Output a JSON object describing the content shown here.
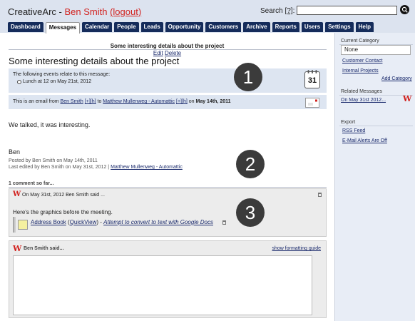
{
  "header": {
    "app_name": "CreativeArc",
    "separator": " - ",
    "user_name": "Ben Smith",
    "logout_label": "(logout)",
    "search_label": "Search",
    "search_help": "[?]",
    "search_colon": ":",
    "search_value": "",
    "search_button_icon": "magnifier-icon"
  },
  "tabs": [
    {
      "label": "Dashboard",
      "active": false
    },
    {
      "label": "Messages",
      "active": true
    },
    {
      "label": "Calendar",
      "active": false
    },
    {
      "label": "People",
      "active": false
    },
    {
      "label": "Leads",
      "active": false
    },
    {
      "label": "Opportunity",
      "active": false
    },
    {
      "label": "Customers",
      "active": false
    },
    {
      "label": "Archive",
      "active": false
    },
    {
      "label": "Reports",
      "active": false
    },
    {
      "label": "Users",
      "active": false
    },
    {
      "label": "Settings",
      "active": false
    },
    {
      "label": "Help",
      "active": false
    }
  ],
  "message": {
    "page_title": "Some interesting details about the project",
    "edit_label": "Edit",
    "delete_label": "Delete",
    "title": "Some interesting details about the project",
    "events_intro": "The following events relate to this message:",
    "event_item": "Lunch at 12 on May 21st, 2012",
    "calendar_day": "31",
    "email_prefix": "This is an email from",
    "email_from": "Ben Smith",
    "email_from_tags": "[+][h]",
    "email_to_word": "to",
    "email_to": "Matthew Mullenweg - Automattic",
    "email_to_tags": "[+][h]",
    "email_on": "on",
    "email_date": "May 14th, 2011",
    "body": "We talked, it was interesting.",
    "signature": "Ben",
    "posted_by": "Posted by Ben Smith on May 14th, 2011",
    "last_edited_prefix": "Last edited by Ben Smith on May 31st, 2012 |",
    "last_edited_link": "Matthew Mullenweg - Automattic"
  },
  "comments": {
    "count_label": "1 comment so far...",
    "items": [
      {
        "header": "On May 31st, 2012 Ben Smith said ...",
        "text": "Here's the graphics before the meeting.",
        "attachment_name": "Address Book",
        "quickview_label": "QuickView",
        "attachment_dash": " - ",
        "convert_label": "Attempt to convert to text with Google Docs"
      }
    ]
  },
  "reply": {
    "who": "Ben Smith said...",
    "formatting_link": "show formatting guide",
    "text": ""
  },
  "badges": [
    "1",
    "2",
    "3"
  ],
  "sidebar": {
    "current_category_heading": "Current Category",
    "category_value": "None",
    "links": [
      "Customer Contact",
      "Internal Projects"
    ],
    "add_category": "Add Category",
    "related_heading": "Related Messages",
    "related_item": "On May 31st 2012...",
    "export_heading": "Export",
    "export_links": [
      "RSS Feed",
      "E-Mail Alerts Are Off"
    ]
  },
  "colors": {
    "accent_red": "#d2221f",
    "tab_navy": "#152c5b",
    "header_bg": "#dce3ef",
    "badge_dark": "#3b3b3b"
  }
}
